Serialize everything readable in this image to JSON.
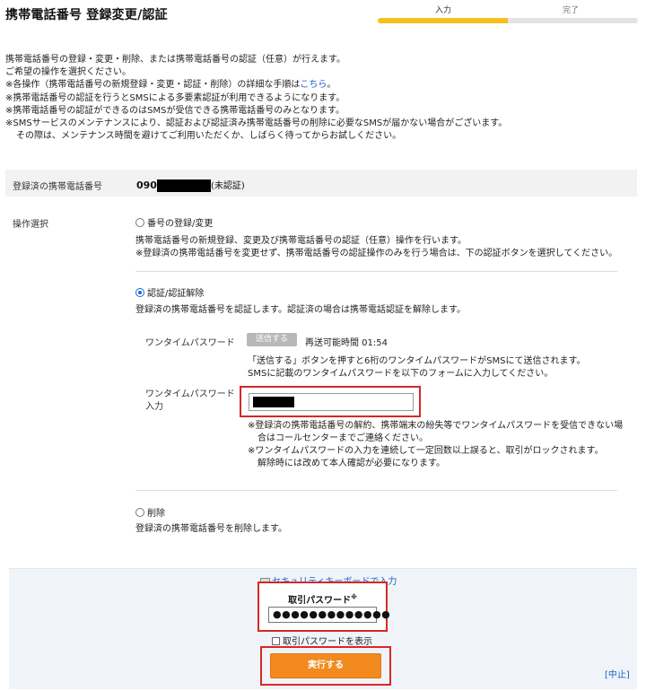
{
  "header": {
    "title": "携帯電話番号 登録変更/認証",
    "steps": [
      {
        "label": "入力",
        "state": "active"
      },
      {
        "label": "完了",
        "state": "inactive"
      }
    ],
    "active_color": "#f4c020"
  },
  "intro": {
    "line1": "携帯電話番号の登録・変更・削除、または携帯電話番号の認証（任意）が行えます。",
    "line2": "ご希望の操作を選択ください。",
    "line3_pre": "※各操作（携帯電話番号の新規登録・変更・認証・削除）の詳細な手順は",
    "line3_link": "こちら",
    "line3_post": "。",
    "line4": "※携帯電話番号の認証を行うとSMSによる多要素認証が利用できるようになります。",
    "line5": "※携帯電話番号の認証ができるのはSMSが受信できる携帯電話番号のみとなります。",
    "line6": "※SMSサービスのメンテナンスにより、認証および認証済み携帯電話番号の削除に必要なSMSが届かない場合がございます。",
    "line7": "その際は、メンテナンス時間を避けてご利用いただくか、しばらく待ってからお試しください。"
  },
  "registered": {
    "label": "登録済の携帯電話番号",
    "prefix": "090",
    "status": "(未認証)"
  },
  "operation": {
    "label": "操作選択",
    "options": [
      {
        "label": "番号の登録/変更",
        "checked": false,
        "desc1": "携帯電話番号の新規登録、変更及び携帯電話番号の認証（任意）操作を行います。",
        "desc2": "※登録済の携帯電話番号を変更せず、携帯電話番号の認証操作のみを行う場合は、下の認証ボタンを選択してください。"
      },
      {
        "label": "認証/認証解除",
        "checked": true,
        "desc1": "登録済の携帯電話番号を認証します。認証済の場合は携帯電話認証を解除します。"
      },
      {
        "label": "削除",
        "checked": false,
        "desc1": "登録済の携帯電話番号を削除します。"
      }
    ]
  },
  "otp": {
    "label": "ワンタイムパスワード",
    "send_button": "送信する",
    "resend": "再送可能時間 01:54",
    "note1": "「送信する」ボタンを押すと6桁のワンタイムパスワードがSMSにて送信されます。",
    "note2": "SMSに記載のワンタイムパスワードを以下のフォームに入力してください。",
    "input_label1": "ワンタイムパスワード",
    "input_label2": "入力",
    "warn1": "※登録済の携帯電話番号の解約、携帯端末の紛失等でワンタイムパスワードを受信できない場",
    "warn2": "合はコールセンターまでご連絡ください。",
    "warn3": "※ワンタイムパスワードの入力を連続して一定回数以上誤ると、取引がロックされます。",
    "warn4": "解除時には改めて本人確認が必要になります。"
  },
  "footer": {
    "security_keyboard": "セキュリティキーボードで入力",
    "password_label": "取引パスワード",
    "password_mark": "※",
    "password_value": "●●●●●●●●●●●●●",
    "show_password": "取引パスワードを表示",
    "execute": "実行する",
    "cancel": "[中止]",
    "execute_color": "#f28a1e",
    "highlight_color": "#d62828"
  }
}
